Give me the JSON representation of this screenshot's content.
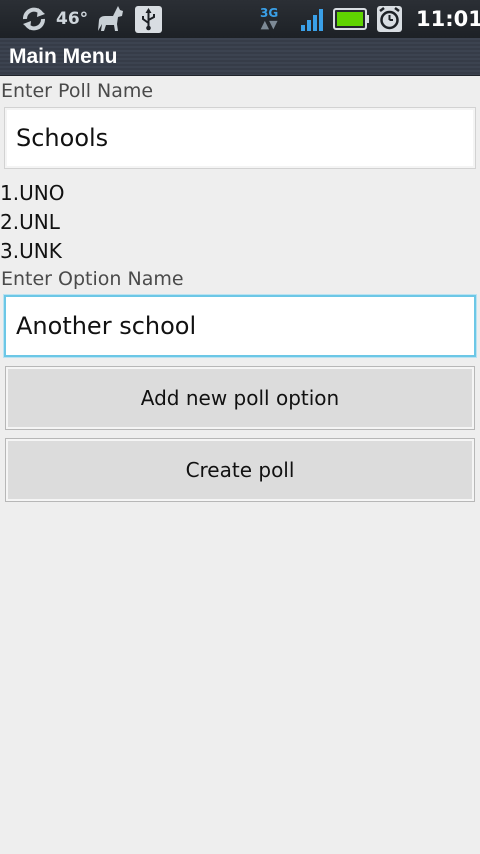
{
  "status_bar": {
    "temperature": "46°",
    "network": "3G",
    "time": "11:01",
    "icons": [
      "sync-icon",
      "weather-icon",
      "cat-icon",
      "usb-icon",
      "3g-icon",
      "signal-icon",
      "battery-icon",
      "alarm-icon"
    ],
    "battery_color": "#5fd400"
  },
  "header": {
    "title": "Main Menu"
  },
  "form": {
    "poll_name_label": "Enter Poll Name",
    "poll_name_value": "Schools",
    "options": [
      {
        "number": "1.",
        "name": "UNO"
      },
      {
        "number": "2.",
        "name": "UNL"
      },
      {
        "number": "3.",
        "name": "UNK"
      }
    ],
    "option_name_label": "Enter Option Name",
    "option_name_value": "Another school",
    "add_option_button": "Add new poll option",
    "create_poll_button": "Create poll"
  },
  "colors": {
    "focus_border": "#6cc7e6",
    "background": "#eeeeee"
  }
}
